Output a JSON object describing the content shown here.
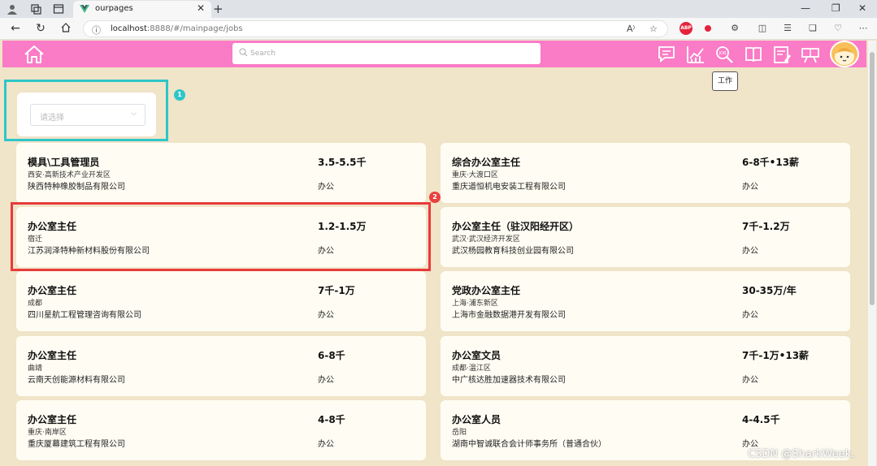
{
  "browser": {
    "tab_title": "ourpages",
    "url_host": "localhost",
    "url_rest": ":8888/#/mainpage/jobs",
    "abp_label": "ABP"
  },
  "header": {
    "search_placeholder": "Search",
    "tooltip": "工作",
    "icons": [
      "message-icon",
      "chart-icon",
      "job-search-icon",
      "book-icon",
      "resume-icon",
      "certificate-icon"
    ]
  },
  "filter": {
    "placeholder": "请选择"
  },
  "annotations": {
    "badge1": "1",
    "badge2": "2"
  },
  "jobs": [
    {
      "title": "模具\\工具管理员",
      "salary": "3.5-5.5千",
      "location": "西安·高新技术产业开发区",
      "company": "陕西特种橡胶制品有限公司",
      "category": "办公"
    },
    {
      "title": "综合办公室主任",
      "salary": "6-8千•13薪",
      "location": "重庆·大渡口区",
      "company": "重庆道恒机电安装工程有限公司",
      "category": "办公"
    },
    {
      "title": "办公室主任",
      "salary": "1.2-1.5万",
      "location": "宿迁",
      "company": "江苏润泽特种新材料股份有限公司",
      "category": "办公"
    },
    {
      "title": "办公室主任（驻汉阳经开区）",
      "salary": "7千-1.2万",
      "location": "武汉·武汉经济开发区",
      "company": "武汉杨园教育科技创业园有限公司",
      "category": "办公"
    },
    {
      "title": "办公室主任",
      "salary": "7千-1万",
      "location": "成都",
      "company": "四川星航工程管理咨询有限公司",
      "category": "办公"
    },
    {
      "title": "党政办公室主任",
      "salary": "30-35万/年",
      "location": "上海·浦东新区",
      "company": "上海市金融数据港开发有限公司",
      "category": "办公"
    },
    {
      "title": "办公室主任",
      "salary": "6-8千",
      "location": "曲靖",
      "company": "云南天创能源材料有限公司",
      "category": "办公"
    },
    {
      "title": "办公室文员",
      "salary": "7千-1万•13薪",
      "location": "成都·温江区",
      "company": "中广核达胜加速器技术有限公司",
      "category": "办公"
    },
    {
      "title": "办公室主任",
      "salary": "4-8千",
      "location": "重庆·南岸区",
      "company": "重庆厦幕建筑工程有限公司",
      "category": "办公"
    },
    {
      "title": "办公室人员",
      "salary": "4-4.5千",
      "location": "岳阳",
      "company": "湖南中智诚联合会计师事务所（普通合伙）",
      "category": "办公"
    }
  ],
  "watermark": "CSDN @SharkWeek."
}
